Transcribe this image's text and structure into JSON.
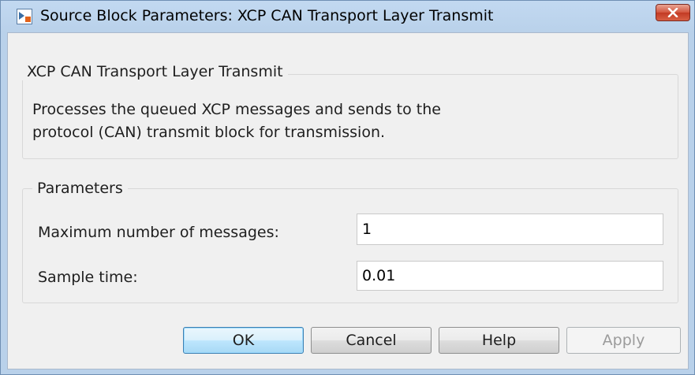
{
  "window": {
    "title": "Source Block Parameters: XCP CAN Transport Layer Transmit"
  },
  "description_group": {
    "title": "XCP CAN Transport Layer Transmit",
    "lines": [
      "Processes the queued XCP messages and sends to the",
      "protocol (CAN) transmit block for transmission."
    ]
  },
  "parameters_group": {
    "title": "Parameters",
    "fields": [
      {
        "label": "Maximum number of messages:",
        "value": "1"
      },
      {
        "label": "Sample time:",
        "value": "0.01"
      }
    ]
  },
  "buttons": {
    "ok": "OK",
    "cancel": "Cancel",
    "help": "Help",
    "apply": "Apply"
  },
  "colors": {
    "close_button": "#c73b25",
    "default_button_border": "#3c7fb1"
  }
}
